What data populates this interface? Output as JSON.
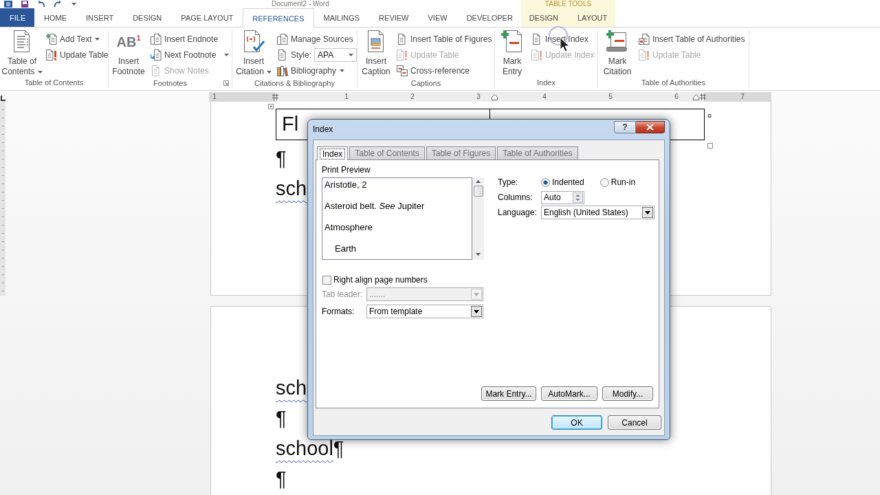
{
  "title_bar": {
    "title": "Document2 - Word",
    "context_label": "TABLE TOOLS"
  },
  "ribbon_tabs": [
    {
      "label": "FILE",
      "kind": "file",
      "selected": false
    },
    {
      "label": "HOME",
      "kind": "standard",
      "selected": false
    },
    {
      "label": "INSERT",
      "kind": "standard",
      "selected": false
    },
    {
      "label": "DESIGN",
      "kind": "standard",
      "selected": false
    },
    {
      "label": "PAGE LAYOUT",
      "kind": "standard",
      "selected": false
    },
    {
      "label": "REFERENCES",
      "kind": "standard",
      "selected": true
    },
    {
      "label": "MAILINGS",
      "kind": "standard",
      "selected": false
    },
    {
      "label": "REVIEW",
      "kind": "standard",
      "selected": false
    },
    {
      "label": "VIEW",
      "kind": "standard",
      "selected": false
    },
    {
      "label": "DEVELOPER",
      "kind": "standard",
      "selected": false
    },
    {
      "label": "DESIGN",
      "kind": "contextual",
      "selected": false
    },
    {
      "label": "LAYOUT",
      "kind": "contextual",
      "selected": false
    }
  ],
  "ribbon_groups": [
    {
      "label": "Table of Contents",
      "large_button": {
        "label": "Table of Contents",
        "dropdown": true
      },
      "small_buttons": [
        {
          "kind": "button",
          "label": "Add Text",
          "dropdown": true,
          "disabled": false
        },
        {
          "kind": "button",
          "label": "Update Table",
          "dropdown": false,
          "disabled": false
        }
      ]
    },
    {
      "label": "Footnotes",
      "launcher": true,
      "large_button": {
        "label": "Insert Footnote",
        "dropdown": false,
        "icon_text": "AB$^{1}$"
      },
      "small_buttons": [
        {
          "kind": "button",
          "label": "Insert Endnote",
          "dropdown": false,
          "disabled": false
        },
        {
          "kind": "button",
          "label": "Next Footnote",
          "dropdown": true,
          "disabled": false
        },
        {
          "kind": "button",
          "label": "Show Notes",
          "dropdown": false,
          "disabled": true
        }
      ]
    },
    {
      "label": "Citations & Bibliography",
      "large_button": {
        "label": "Insert Citation",
        "dropdown": true
      },
      "small_buttons": [
        {
          "kind": "button",
          "label": "Manage Sources",
          "dropdown": false,
          "disabled": false
        },
        {
          "kind": "combo",
          "label": "Style:",
          "value": "APA"
        },
        {
          "kind": "button",
          "label": "Bibliography",
          "dropdown": true,
          "disabled": false
        }
      ]
    },
    {
      "label": "Captions",
      "large_button": {
        "label": "Insert Caption",
        "dropdown": false
      },
      "small_buttons": [
        {
          "kind": "button",
          "label": "Insert Table of Figures",
          "dropdown": false,
          "disabled": false
        },
        {
          "kind": "button",
          "label": "Update Table",
          "dropdown": false,
          "disabled": true
        },
        {
          "kind": "button",
          "label": "Cross-reference",
          "dropdown": false,
          "disabled": false
        }
      ]
    },
    {
      "label": "Index",
      "large_button": {
        "label": "Mark Entry",
        "dropdown": false
      },
      "small_buttons": [
        {
          "kind": "button",
          "label": "Insert Index",
          "dropdown": false,
          "disabled": false
        },
        {
          "kind": "button",
          "label": "Update Index",
          "dropdown": false,
          "disabled": true
        }
      ]
    },
    {
      "label": "Table of Authorities",
      "large_button": {
        "label": "Mark Citation",
        "dropdown": false
      },
      "small_buttons": [
        {
          "kind": "button",
          "label": "Insert Table of Authorities",
          "dropdown": false,
          "disabled": false
        },
        {
          "kind": "button",
          "label": "Update Table",
          "dropdown": false,
          "disabled": true
        }
      ]
    }
  ],
  "ruler": {
    "left_numbers": [
      "1"
    ],
    "right_numbers": [
      "1",
      "2",
      "3",
      "4",
      "5",
      "6",
      "7"
    ]
  },
  "pages": [
    {
      "table": {
        "first_cell": "Fl",
        "row_end_mark": "¤"
      },
      "lines": [
        {
          "paragraph_mark": "¶"
        },
        {
          "text": "sch",
          "spelling_error": true
        }
      ]
    },
    {
      "lines": [
        {
          "text": "sch",
          "spelling_error": true
        },
        {
          "paragraph_mark": "¶"
        },
        {
          "text": "school",
          "spelling_error": true,
          "paragraph_mark": "¶"
        },
        {
          "paragraph_mark": "¶"
        }
      ]
    }
  ],
  "dialog": {
    "title": "Index",
    "help_label": "?",
    "tabs": [
      {
        "label": "Index",
        "selected": true
      },
      {
        "label": "Table of Contents",
        "selected": false
      },
      {
        "label": "Table of Figures",
        "selected": false
      },
      {
        "label": "Table of Authorities",
        "selected": false
      }
    ],
    "preview": {
      "label": "Print Preview",
      "entries": [
        {
          "text": "Aristotle, 2"
        },
        {
          "text": "Asteroid belt. *See* Jupiter"
        },
        {
          "text": "Atmosphere",
          "children": [
            {
              "text": "Earth"
            }
          ]
        }
      ]
    },
    "type": {
      "label": "Type:",
      "options": [
        {
          "label": "Indented",
          "selected": true
        },
        {
          "label": "Run-in",
          "selected": false
        }
      ]
    },
    "columns": {
      "label": "Columns:",
      "value": "Auto"
    },
    "language": {
      "label": "Language:",
      "value": "English (United States)"
    },
    "right_align": {
      "label": "Right align page numbers",
      "checked": false
    },
    "tab_leader": {
      "label": "Tab leader:",
      "value": ".......",
      "disabled": true
    },
    "formats": {
      "label": "Formats:",
      "value": "From template",
      "disabled": false
    },
    "action_buttons": [
      {
        "label": "Mark Entry..."
      },
      {
        "label": "AutoMark..."
      },
      {
        "label": "Modify..."
      }
    ],
    "footer_buttons": [
      {
        "label": "OK",
        "default": true
      },
      {
        "label": "Cancel",
        "default": false
      }
    ]
  }
}
